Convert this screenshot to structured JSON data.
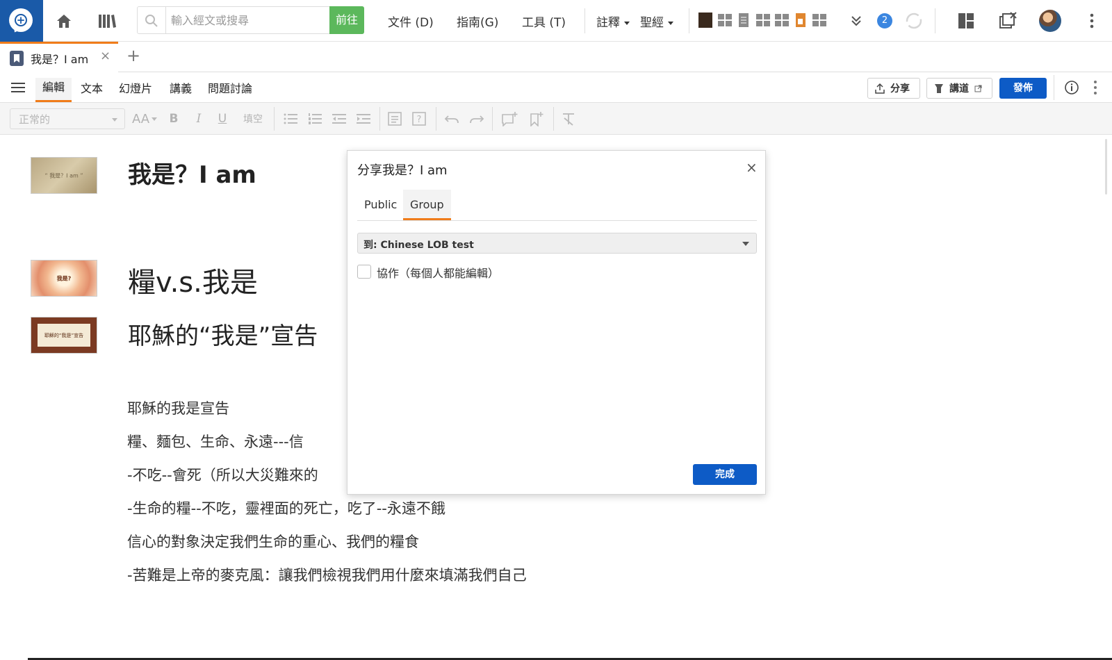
{
  "search": {
    "placeholder": "輸入經文或搜尋",
    "go_label": "前往"
  },
  "menus": {
    "file": "文件 (D)",
    "guides": "指南(G)",
    "tools": "工具 (T)",
    "notes": "註釋",
    "bible": "聖經"
  },
  "notifications": {
    "count": "2"
  },
  "tab": {
    "title": "我是？I am",
    "close": "×",
    "add": "+"
  },
  "modes": {
    "edit": "編輯",
    "text": "文本",
    "slides": "幻燈片",
    "handout": "講義",
    "discussion": "問題討論"
  },
  "actions": {
    "share": "分享",
    "sermon": "講道",
    "publish": "發佈"
  },
  "format": {
    "style_value": "正常的",
    "font_size": "AA",
    "bold": "B",
    "italic": "I",
    "underline": "U",
    "fill_blank": "填空"
  },
  "document": {
    "slides": [
      {
        "thumb_text": "“ 我是？I am ”",
        "heading": "我是？I am"
      },
      {
        "thumb_text": "我是?",
        "heading": "糧v.s.我是"
      },
      {
        "thumb_text": "耶穌的“我是”宣告",
        "heading": "耶穌的“我是”宣告"
      }
    ],
    "paragraphs": [
      "耶穌的我是宣告",
      "糧、麵包、生命、永遠---信",
      "-不吃--會死（所以大災難來的",
      "-生命的糧--不吃，靈裡面的死亡，吃了--永遠不餓",
      "信心的對象決定我們生命的重心、我們的糧食",
      "-苦難是上帝的麥克風：讓我們檢視我們用什麼來填滿我們自己"
    ]
  },
  "share_dialog": {
    "title": "分享我是？I am",
    "close": "×",
    "tabs": [
      "Public",
      "Group"
    ],
    "active_tab": "Group",
    "group_select": "到: Chinese LOB test",
    "collaborate_label": "協作（每個人都能編輯）",
    "collaborate_checked": false,
    "done_label": "完成"
  },
  "colors": {
    "brand": "#1a5aa8",
    "accent": "#f07c1a",
    "primary_button": "#0d5bc6",
    "go_button": "#5cb85c"
  }
}
